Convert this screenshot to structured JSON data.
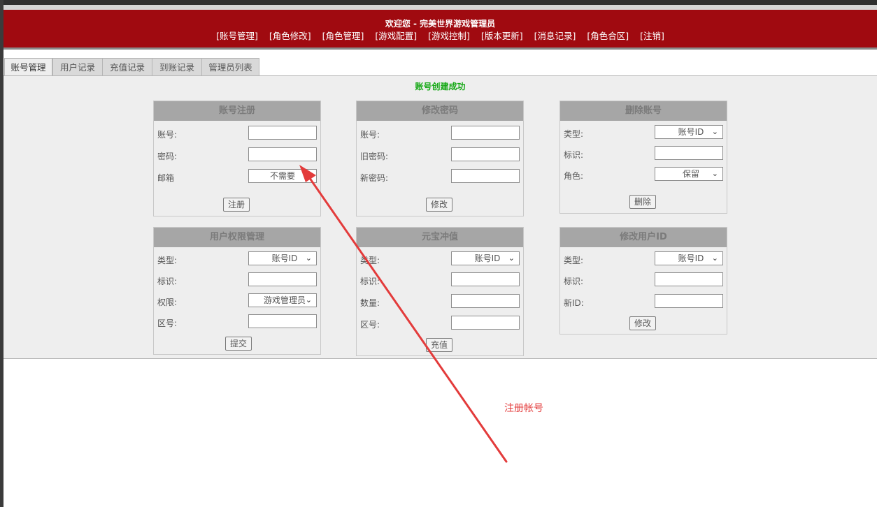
{
  "header": {
    "welcome": "欢迎您 - 完美世界游戏管理员",
    "nav": [
      "[账号管理]",
      "[角色修改]",
      "[角色管理]",
      "[游戏配置]",
      "[游戏控制]",
      "[版本更新]",
      "[消息记录]",
      "[角色合区]",
      "[注销]"
    ]
  },
  "tabs": [
    "账号管理",
    "用户记录",
    "充值记录",
    "到账记录",
    "管理员列表"
  ],
  "active_tab": "账号管理",
  "status_message": "账号创建成功",
  "boxes": {
    "register": {
      "title": "账号注册",
      "account_label": "账号:",
      "password_label": "密码:",
      "email_label": "邮箱",
      "email_value": "不需要",
      "button": "注册"
    },
    "change_password": {
      "title": "修改密码",
      "account_label": "账号:",
      "old_label": "旧密码:",
      "new_label": "新密码:",
      "button": "修改"
    },
    "delete_account": {
      "title": "删除账号",
      "type_label": "类型:",
      "type_value": "账号ID",
      "id_label": "标识:",
      "role_label": "角色:",
      "role_value": "保留",
      "button": "删除"
    },
    "permissions": {
      "title": "用户权限管理",
      "type_label": "类型:",
      "type_value": "账号ID",
      "id_label": "标识:",
      "perm_label": "权限:",
      "perm_value": "游戏管理员",
      "zone_label": "区号:",
      "button": "提交"
    },
    "recharge": {
      "title": "元宝冲值",
      "type_label": "类型:",
      "type_value": "账号ID",
      "id_label": "标识:",
      "amount_label": "数量:",
      "zone_label": "区号:",
      "button": "充值"
    },
    "change_uid": {
      "title": "修改用户ID",
      "type_label": "类型:",
      "type_value": "账号ID",
      "id_label": "标识:",
      "newid_label": "新ID:",
      "button": "修改"
    }
  },
  "annotation": {
    "text": "注册帐号",
    "color": "#e33b3b"
  },
  "colors": {
    "header_bg": "#a00a10",
    "status_green": "#14a814"
  }
}
